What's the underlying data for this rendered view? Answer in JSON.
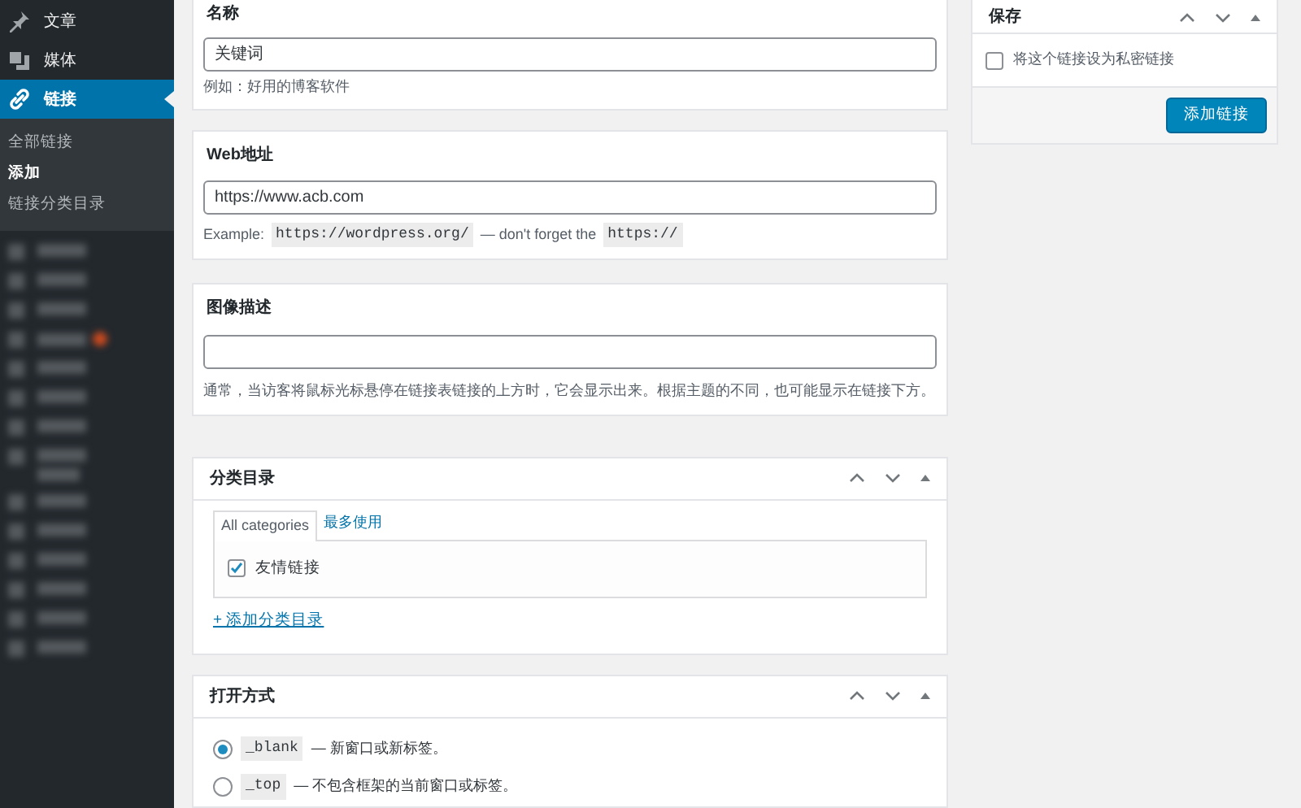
{
  "sidebar": {
    "items": [
      {
        "label": "文章",
        "selected": false
      },
      {
        "label": "媒体",
        "selected": false
      },
      {
        "label": "链接",
        "selected": true
      }
    ],
    "submenu": [
      {
        "label": "全部链接",
        "selected": false
      },
      {
        "label": "添加",
        "selected": true
      },
      {
        "label": "链接分类目录",
        "selected": false
      }
    ],
    "blurred_items": [
      {
        "badge": false,
        "tall": false
      },
      {
        "badge": false,
        "tall": false
      },
      {
        "badge": false,
        "tall": false
      },
      {
        "badge": true,
        "tall": false
      },
      {
        "badge": false,
        "tall": false
      },
      {
        "badge": false,
        "tall": false
      },
      {
        "badge": false,
        "tall": false
      },
      {
        "badge": false,
        "tall": true
      },
      {
        "badge": false,
        "tall": false
      },
      {
        "badge": false,
        "tall": false
      },
      {
        "badge": false,
        "tall": false
      },
      {
        "badge": false,
        "tall": false
      },
      {
        "badge": false,
        "tall": false
      },
      {
        "badge": false,
        "tall": false
      }
    ]
  },
  "name_box": {
    "title": "名称",
    "value": "关键词",
    "hint": "例如：好用的博客软件"
  },
  "url_box": {
    "title": "Web地址",
    "value": "https://www.acb.com",
    "hint_parts": [
      {
        "kind": "text",
        "text": "Example:"
      },
      {
        "kind": "code",
        "text": "https://wordpress.org/"
      },
      {
        "kind": "text",
        "text": "— don't forget the"
      },
      {
        "kind": "code",
        "text": "https://"
      }
    ]
  },
  "description_box": {
    "title": "图像描述",
    "hint": "通常，当访客将鼠标光标悬停在链接表链接的上方时，它会显示出来。根据主题的不同，也可能显示在链接下方。"
  },
  "categories_box": {
    "title": "分类目录",
    "tabs": [
      {
        "label": "All categories",
        "selected": true
      },
      {
        "label": "最多使用",
        "selected": false
      }
    ],
    "categories": [
      {
        "label": "友情链接",
        "checked": true
      }
    ],
    "add_link": "+ 添加分类目录"
  },
  "target_box": {
    "title": "打开方式",
    "options": [
      {
        "code": "_blank",
        "label": "— 新窗口或新标签。",
        "selected": true
      },
      {
        "code": "_top",
        "label": "— 不包含框架的当前窗口或标签。",
        "selected": false
      }
    ]
  },
  "save_box": {
    "title": "保存",
    "private": {
      "label": "将这个链接设为私密链接",
      "checked": false
    },
    "button": "添加链接"
  }
}
